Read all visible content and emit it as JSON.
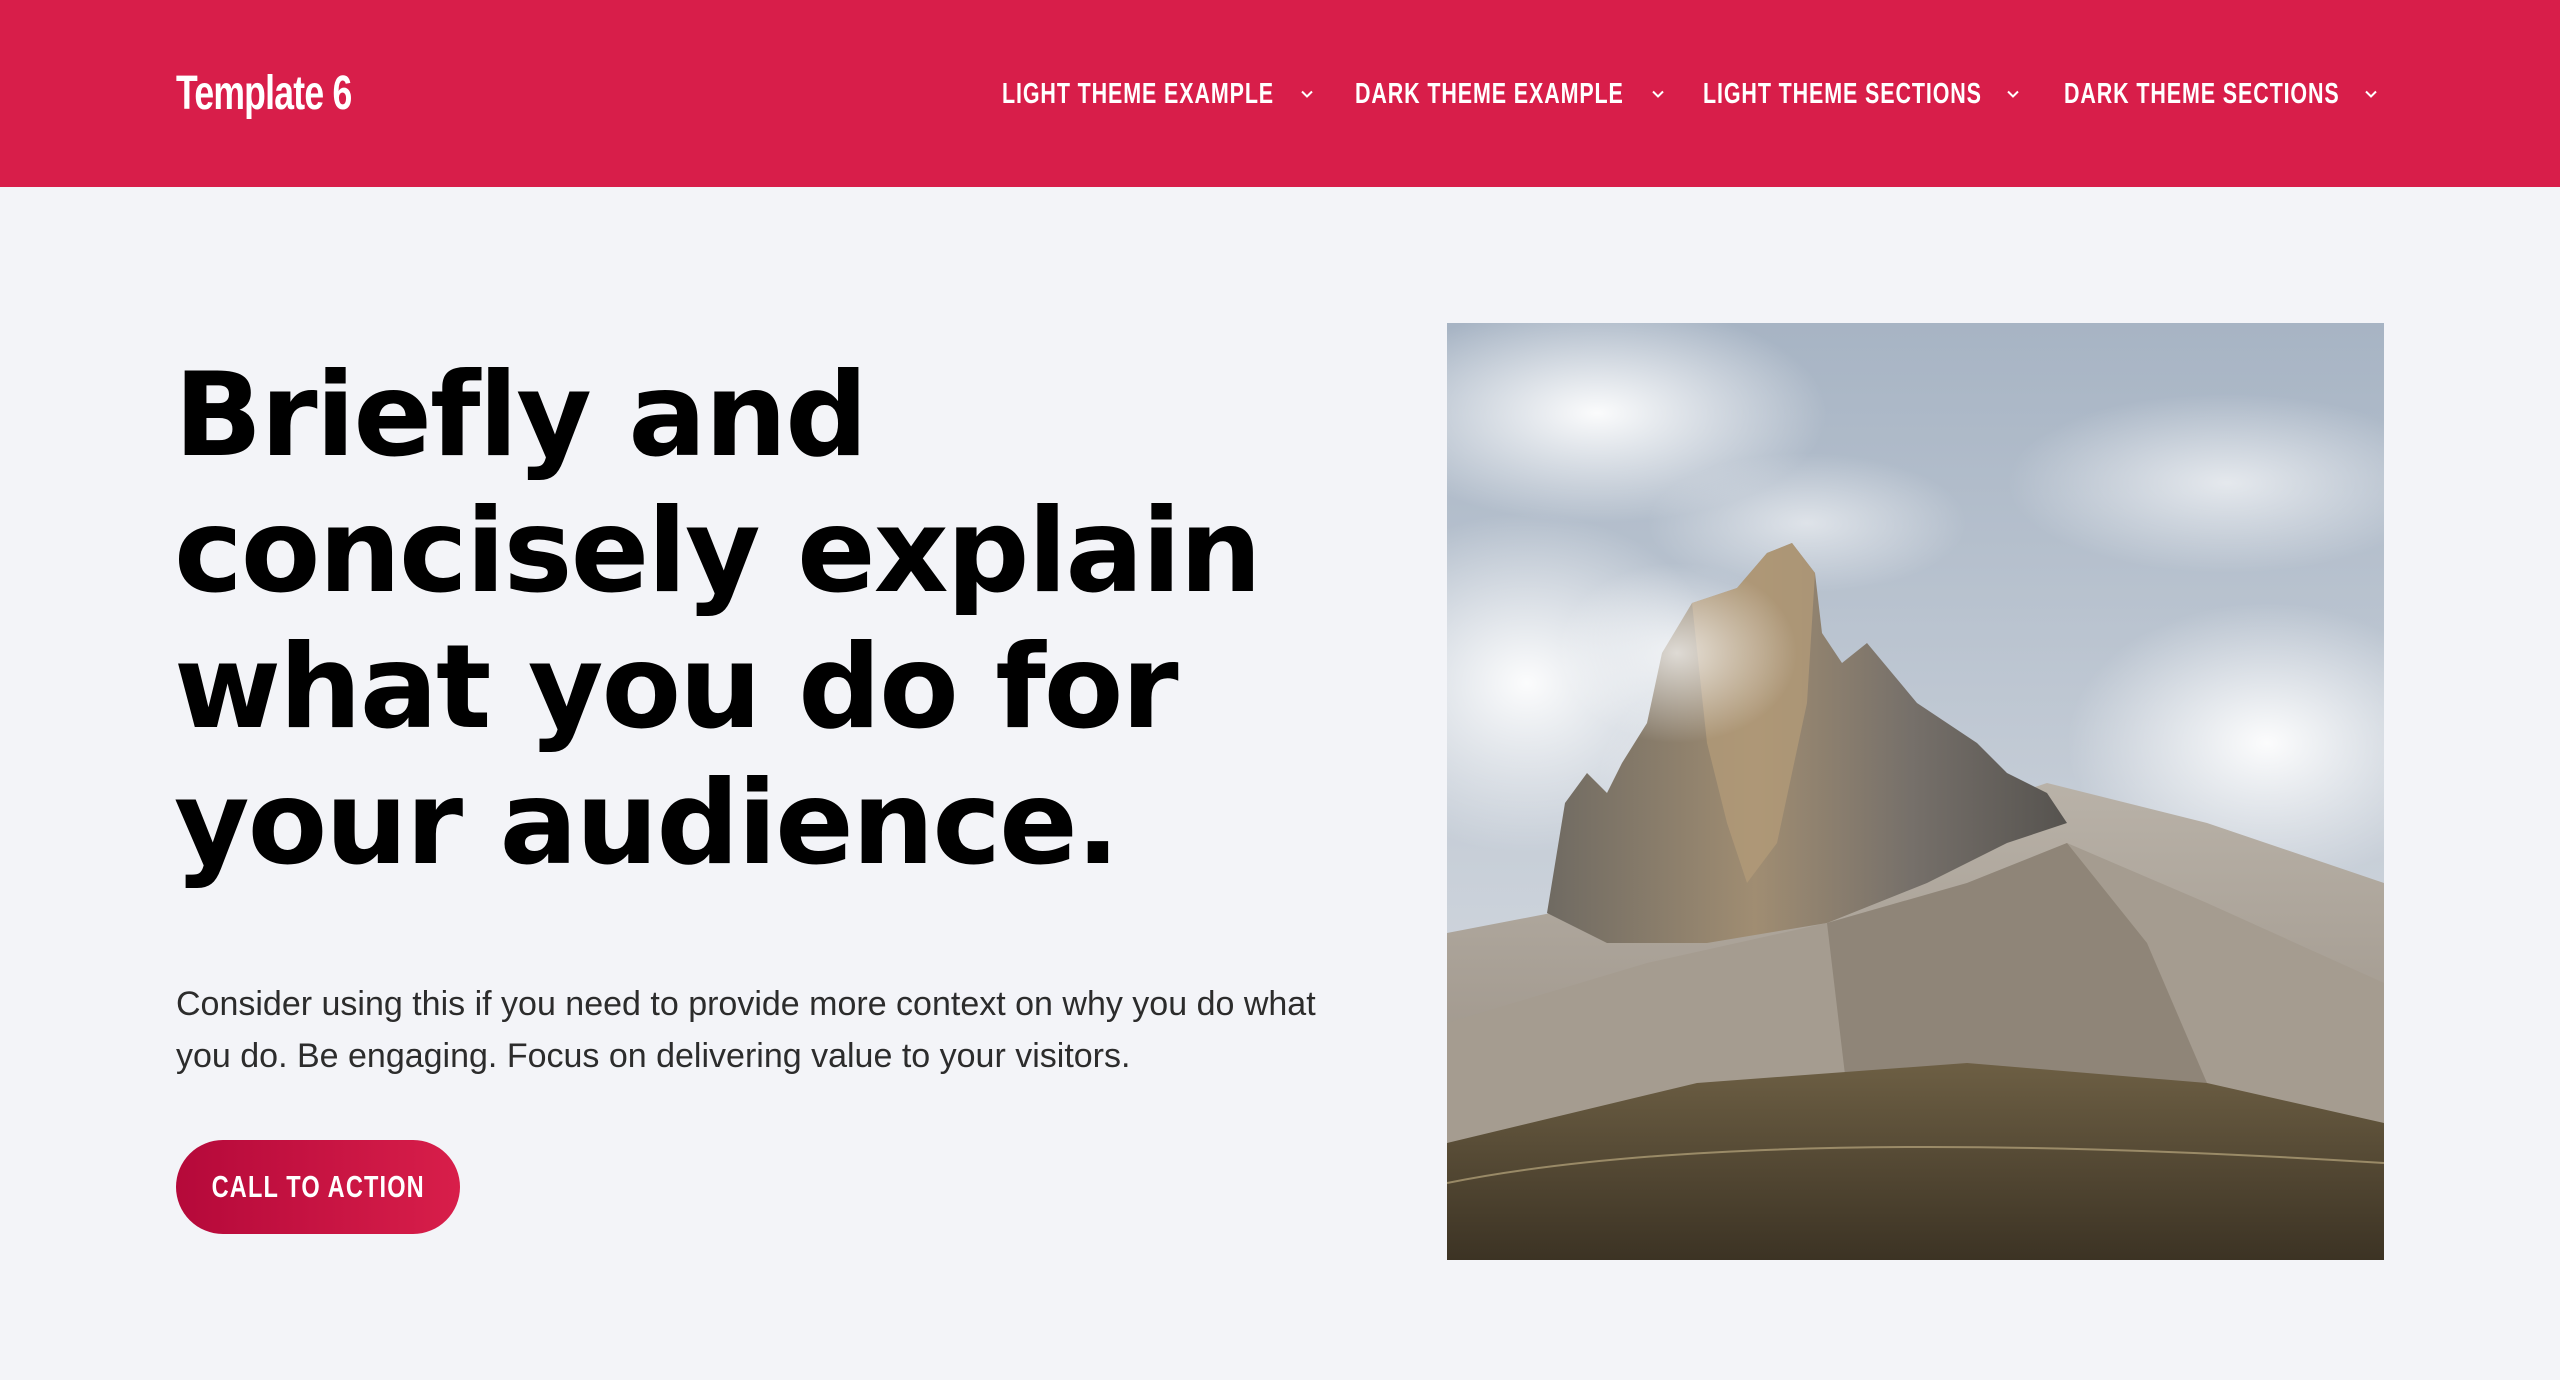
{
  "header": {
    "brand": "Template 6",
    "bg_color": "#d81e4a",
    "nav": [
      {
        "label": "LIGHT THEME EXAMPLE",
        "icon": "chevron-down-icon"
      },
      {
        "label": "DARK THEME EXAMPLE",
        "icon": "chevron-down-icon"
      },
      {
        "label": "LIGHT THEME SECTIONS",
        "icon": "chevron-down-icon"
      },
      {
        "label": "DARK THEME SECTIONS",
        "icon": "chevron-down-icon"
      }
    ]
  },
  "hero": {
    "title": "Briefly and concisely explain what you do for your audience.",
    "text": "Consider using this if you need to provide more context on why you do what you do. Be engaging. Focus on delivering value to your visitors.",
    "cta_label": "CALL TO ACTION",
    "cta_color": "#c2103f",
    "image": "mountain-peak-photo"
  },
  "colors": {
    "background": "#f3f4f8",
    "accent": "#d81e4a",
    "text": "#000000"
  }
}
